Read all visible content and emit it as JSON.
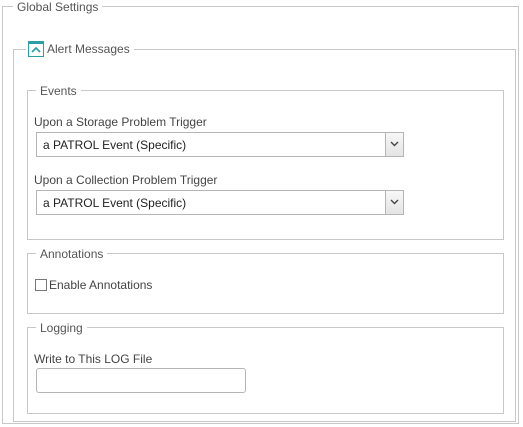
{
  "global_settings": {
    "title": "Global Settings"
  },
  "alert_messages": {
    "title": "Alert Messages",
    "collapse_icon": "chevron-up-icon",
    "accent_color": "#2a9ea5",
    "events": {
      "title": "Events",
      "storage_trigger": {
        "label": "Upon a Storage Problem Trigger",
        "value": "a PATROL Event (Specific)"
      },
      "collection_trigger": {
        "label": "Upon a Collection Problem Trigger",
        "value": "a PATROL Event (Specific)"
      }
    },
    "annotations": {
      "title": "Annotations",
      "enable_label": "Enable Annotations",
      "enabled": false
    },
    "logging": {
      "title": "Logging",
      "log_file_label": "Write to This LOG File",
      "log_file_value": ""
    }
  }
}
